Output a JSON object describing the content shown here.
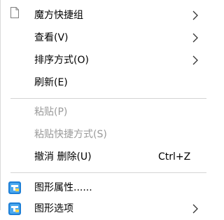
{
  "menu": {
    "items": [
      {
        "label": "魔方快捷组"
      },
      {
        "label": "查看(V)"
      },
      {
        "label": "排序方式(O)"
      },
      {
        "label": "刷新(E)"
      },
      {
        "label": "粘贴(P)"
      },
      {
        "label": "粘贴快捷方式(S)"
      },
      {
        "label": "撤消 删除(U)",
        "shortcut": "Ctrl+Z"
      },
      {
        "label": "图形属性......"
      },
      {
        "label": "图形选项"
      }
    ]
  },
  "colors": {
    "text": "#000000",
    "disabled_text": "#9a9a9a",
    "separator": "#d4d4d4",
    "graphics_icon_blue": "#1e7fd6"
  },
  "icons": {
    "rubik": "doc-icon",
    "graphics_props": "intel-graphics-icon",
    "graphics_options": "intel-graphics-icon",
    "submenu": "chevron-right-icon"
  }
}
